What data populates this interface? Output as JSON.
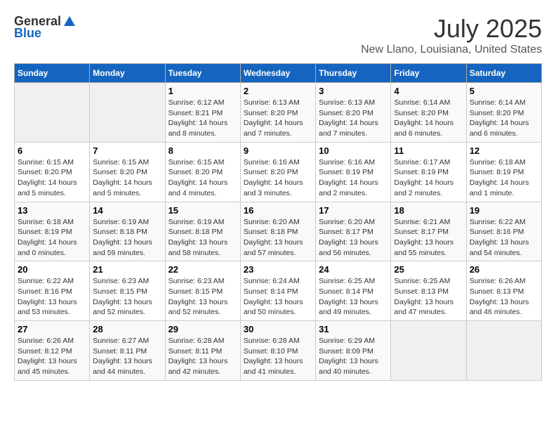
{
  "header": {
    "logo_general": "General",
    "logo_blue": "Blue",
    "month_title": "July 2025",
    "location": "New Llano, Louisiana, United States"
  },
  "days_of_week": [
    "Sunday",
    "Monday",
    "Tuesday",
    "Wednesday",
    "Thursday",
    "Friday",
    "Saturday"
  ],
  "weeks": [
    [
      {
        "day": "",
        "info": ""
      },
      {
        "day": "",
        "info": ""
      },
      {
        "day": "1",
        "info": "Sunrise: 6:12 AM\nSunset: 8:21 PM\nDaylight: 14 hours and 8 minutes."
      },
      {
        "day": "2",
        "info": "Sunrise: 6:13 AM\nSunset: 8:20 PM\nDaylight: 14 hours and 7 minutes."
      },
      {
        "day": "3",
        "info": "Sunrise: 6:13 AM\nSunset: 8:20 PM\nDaylight: 14 hours and 7 minutes."
      },
      {
        "day": "4",
        "info": "Sunrise: 6:14 AM\nSunset: 8:20 PM\nDaylight: 14 hours and 6 minutes."
      },
      {
        "day": "5",
        "info": "Sunrise: 6:14 AM\nSunset: 8:20 PM\nDaylight: 14 hours and 6 minutes."
      }
    ],
    [
      {
        "day": "6",
        "info": "Sunrise: 6:15 AM\nSunset: 8:20 PM\nDaylight: 14 hours and 5 minutes."
      },
      {
        "day": "7",
        "info": "Sunrise: 6:15 AM\nSunset: 8:20 PM\nDaylight: 14 hours and 5 minutes."
      },
      {
        "day": "8",
        "info": "Sunrise: 6:15 AM\nSunset: 8:20 PM\nDaylight: 14 hours and 4 minutes."
      },
      {
        "day": "9",
        "info": "Sunrise: 6:16 AM\nSunset: 8:20 PM\nDaylight: 14 hours and 3 minutes."
      },
      {
        "day": "10",
        "info": "Sunrise: 6:16 AM\nSunset: 8:19 PM\nDaylight: 14 hours and 2 minutes."
      },
      {
        "day": "11",
        "info": "Sunrise: 6:17 AM\nSunset: 8:19 PM\nDaylight: 14 hours and 2 minutes."
      },
      {
        "day": "12",
        "info": "Sunrise: 6:18 AM\nSunset: 8:19 PM\nDaylight: 14 hours and 1 minute."
      }
    ],
    [
      {
        "day": "13",
        "info": "Sunrise: 6:18 AM\nSunset: 8:19 PM\nDaylight: 14 hours and 0 minutes."
      },
      {
        "day": "14",
        "info": "Sunrise: 6:19 AM\nSunset: 8:18 PM\nDaylight: 13 hours and 59 minutes."
      },
      {
        "day": "15",
        "info": "Sunrise: 6:19 AM\nSunset: 8:18 PM\nDaylight: 13 hours and 58 minutes."
      },
      {
        "day": "16",
        "info": "Sunrise: 6:20 AM\nSunset: 8:18 PM\nDaylight: 13 hours and 57 minutes."
      },
      {
        "day": "17",
        "info": "Sunrise: 6:20 AM\nSunset: 8:17 PM\nDaylight: 13 hours and 56 minutes."
      },
      {
        "day": "18",
        "info": "Sunrise: 6:21 AM\nSunset: 8:17 PM\nDaylight: 13 hours and 55 minutes."
      },
      {
        "day": "19",
        "info": "Sunrise: 6:22 AM\nSunset: 8:16 PM\nDaylight: 13 hours and 54 minutes."
      }
    ],
    [
      {
        "day": "20",
        "info": "Sunrise: 6:22 AM\nSunset: 8:16 PM\nDaylight: 13 hours and 53 minutes."
      },
      {
        "day": "21",
        "info": "Sunrise: 6:23 AM\nSunset: 8:15 PM\nDaylight: 13 hours and 52 minutes."
      },
      {
        "day": "22",
        "info": "Sunrise: 6:23 AM\nSunset: 8:15 PM\nDaylight: 13 hours and 52 minutes."
      },
      {
        "day": "23",
        "info": "Sunrise: 6:24 AM\nSunset: 8:14 PM\nDaylight: 13 hours and 50 minutes."
      },
      {
        "day": "24",
        "info": "Sunrise: 6:25 AM\nSunset: 8:14 PM\nDaylight: 13 hours and 49 minutes."
      },
      {
        "day": "25",
        "info": "Sunrise: 6:25 AM\nSunset: 8:13 PM\nDaylight: 13 hours and 47 minutes."
      },
      {
        "day": "26",
        "info": "Sunrise: 6:26 AM\nSunset: 8:13 PM\nDaylight: 13 hours and 46 minutes."
      }
    ],
    [
      {
        "day": "27",
        "info": "Sunrise: 6:26 AM\nSunset: 8:12 PM\nDaylight: 13 hours and 45 minutes."
      },
      {
        "day": "28",
        "info": "Sunrise: 6:27 AM\nSunset: 8:11 PM\nDaylight: 13 hours and 44 minutes."
      },
      {
        "day": "29",
        "info": "Sunrise: 6:28 AM\nSunset: 8:11 PM\nDaylight: 13 hours and 42 minutes."
      },
      {
        "day": "30",
        "info": "Sunrise: 6:28 AM\nSunset: 8:10 PM\nDaylight: 13 hours and 41 minutes."
      },
      {
        "day": "31",
        "info": "Sunrise: 6:29 AM\nSunset: 8:09 PM\nDaylight: 13 hours and 40 minutes."
      },
      {
        "day": "",
        "info": ""
      },
      {
        "day": "",
        "info": ""
      }
    ]
  ]
}
